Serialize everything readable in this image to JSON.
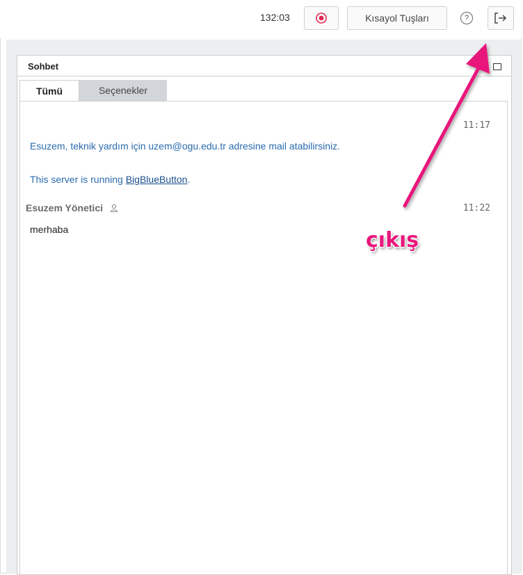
{
  "toolbar": {
    "timer": "132:03",
    "shortcuts_label": "Kısayol Tuşları",
    "help_label": "?"
  },
  "chat": {
    "title": "Sohbet",
    "tabs": [
      "Tümü",
      "Seçenekler"
    ],
    "messages": [
      {
        "time": "11:17",
        "system_lines": [
          "Esuzem, teknik yardım için uzem@ogu.edu.tr adresine mail atabilirsiniz.",
          {
            "prefix": "This server is running ",
            "link": "BigBlueButton",
            "suffix": "."
          }
        ]
      },
      {
        "sender": "Esuzem Yönetici",
        "time": "11:22",
        "text": "merhaba"
      }
    ]
  },
  "annotation": {
    "label": "çıkış",
    "color": "#e8177c"
  },
  "colors": {
    "accent": "#e8177c",
    "record": "#e0274f",
    "system_text": "#2a6bad",
    "tab_inactive_bg": "#d2d6da"
  }
}
